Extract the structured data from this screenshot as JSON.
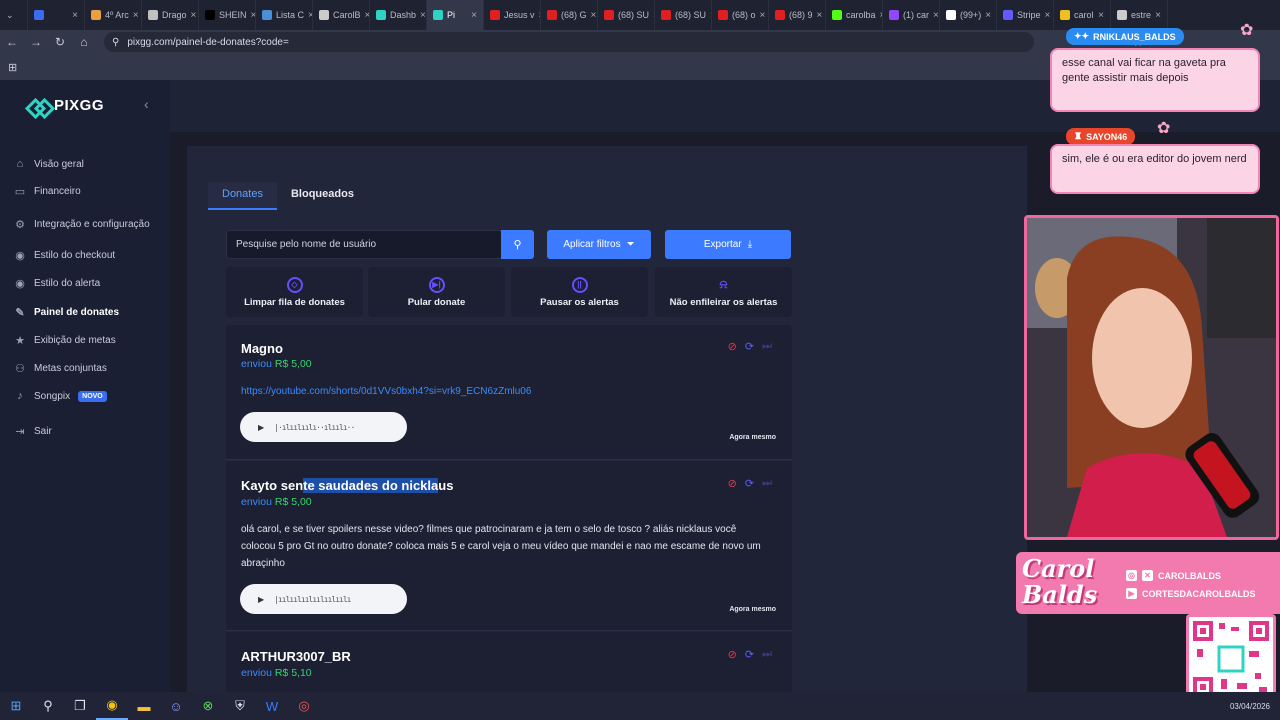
{
  "browser": {
    "tabs": [
      {
        "label": "",
        "color": "#3b6df0",
        "active": false
      },
      {
        "label": "4º Arc",
        "color": "#e8a040",
        "active": false
      },
      {
        "label": "Drago",
        "color": "#c0c0c0",
        "active": false
      },
      {
        "label": "SHEIN",
        "color": "#000000",
        "active": false
      },
      {
        "label": "Lista C",
        "color": "#4a90d9",
        "active": false
      },
      {
        "label": "CarolB",
        "color": "#cccccc",
        "active": false
      },
      {
        "label": "Dashb",
        "color": "#2fd3c3",
        "active": false
      },
      {
        "label": "Pi",
        "color": "#2fd3c3",
        "active": true
      },
      {
        "label": "Jesus v",
        "color": "#e02020",
        "active": false
      },
      {
        "label": "(68) G",
        "color": "#e02020",
        "active": false
      },
      {
        "label": "(68) SU",
        "color": "#e02020",
        "active": false
      },
      {
        "label": "(68) SU",
        "color": "#e02020",
        "active": false
      },
      {
        "label": "(68) o",
        "color": "#e02020",
        "active": false
      },
      {
        "label": "(68) 9",
        "color": "#e02020",
        "active": false
      },
      {
        "label": "carolba",
        "color": "#53fc18",
        "active": false
      },
      {
        "label": "(1) car",
        "color": "#9146ff",
        "active": false
      },
      {
        "label": "(99+)",
        "color": "#ffffff",
        "active": false
      },
      {
        "label": "Stripe",
        "color": "#635bff",
        "active": false
      },
      {
        "label": "carol",
        "color": "#f0c020",
        "active": false
      },
      {
        "label": "estre",
        "color": "#cccccc",
        "active": false
      }
    ],
    "url": "pixgg.com/painel-de-donates?code="
  },
  "sidebar": {
    "logo": "PIXGG",
    "items": [
      {
        "label": "Visão geral",
        "icon": "home-icon",
        "glyph": "⌂"
      },
      {
        "label": "Financeiro",
        "icon": "wallet-icon",
        "glyph": "▭"
      },
      {
        "label": "Integração e configuração",
        "icon": "plug-icon",
        "glyph": "⚙"
      },
      {
        "label": "Estilo do checkout",
        "icon": "palette-icon",
        "glyph": "◉"
      },
      {
        "label": "Estilo do alerta",
        "icon": "palette-icon",
        "glyph": "◉"
      },
      {
        "label": "Painel de donates",
        "icon": "edit-icon",
        "glyph": "✎"
      },
      {
        "label": "Exibição de metas",
        "icon": "star-icon",
        "glyph": "★"
      },
      {
        "label": "Metas conjuntas",
        "icon": "group-icon",
        "glyph": "⚇"
      },
      {
        "label": "Songpix",
        "icon": "music-icon",
        "glyph": "♪"
      },
      {
        "label": "Sair",
        "icon": "logout-icon",
        "glyph": "⇥"
      }
    ],
    "new_badge": "NOVO"
  },
  "panel": {
    "tabs": [
      "Donates",
      "Bloqueados"
    ],
    "search_placeholder": "Pesquise pelo nome de usuário",
    "filter_label": "Aplicar filtros",
    "export_label": "Exportar",
    "actions": [
      {
        "label": "Limpar fila de donates",
        "icon": "eraser-icon",
        "glyph": "◇"
      },
      {
        "label": "Pular donate",
        "icon": "skip-icon",
        "glyph": "▶|"
      },
      {
        "label": "Pausar os alertas",
        "icon": "pause-icon",
        "glyph": "||"
      },
      {
        "label": "Não enfileirar os alertas",
        "icon": "bell-off-icon",
        "glyph": "🔕"
      }
    ]
  },
  "donates": [
    {
      "name": "Magno",
      "sent_prefix": "enviou",
      "amount": "R$ 5,00",
      "link": "https://youtube.com/shorts/0d1VVs0bxh4?si=vrk9_ECN6zZmlu06",
      "message": "",
      "time": "Agora mesmo"
    },
    {
      "name_a": "Kayto sen",
      "name_b": "te saudades do nickla",
      "name_c": "us",
      "sent_prefix": "enviou",
      "amount": "R$ 5,00",
      "message": "olá carol, e se tiver spoilers nesse video? filmes que patrocinaram e ja tem o selo de tosco ? aliás nicklaus você colocou 5 pro Gt no outro donate? coloca mais 5 e carol veja o meu vídeo que mandei e nao me escame de novo um abraçinho",
      "time": "Agora mesmo"
    },
    {
      "name": "ARTHUR3007_BR",
      "sent_prefix": "enviou",
      "amount": "R$ 5,10"
    }
  ],
  "stream": {
    "chat": [
      {
        "user": "RNIKLAUS_BALDS",
        "message": "esse canal vai ficar na gaveta pra gente assistir mais depois",
        "badge_color": "#2a8cf0"
      },
      {
        "user": "SAYON46",
        "message": "sim, ele é ou era editor do jovem nerd",
        "badge_color": "#e8452a"
      }
    ],
    "brand_name": "Carol Balds",
    "socials": [
      "CAROLBALDS",
      "CORTESDACAROLBALDS"
    ]
  },
  "taskbar": {
    "date": "03/04/2026"
  }
}
